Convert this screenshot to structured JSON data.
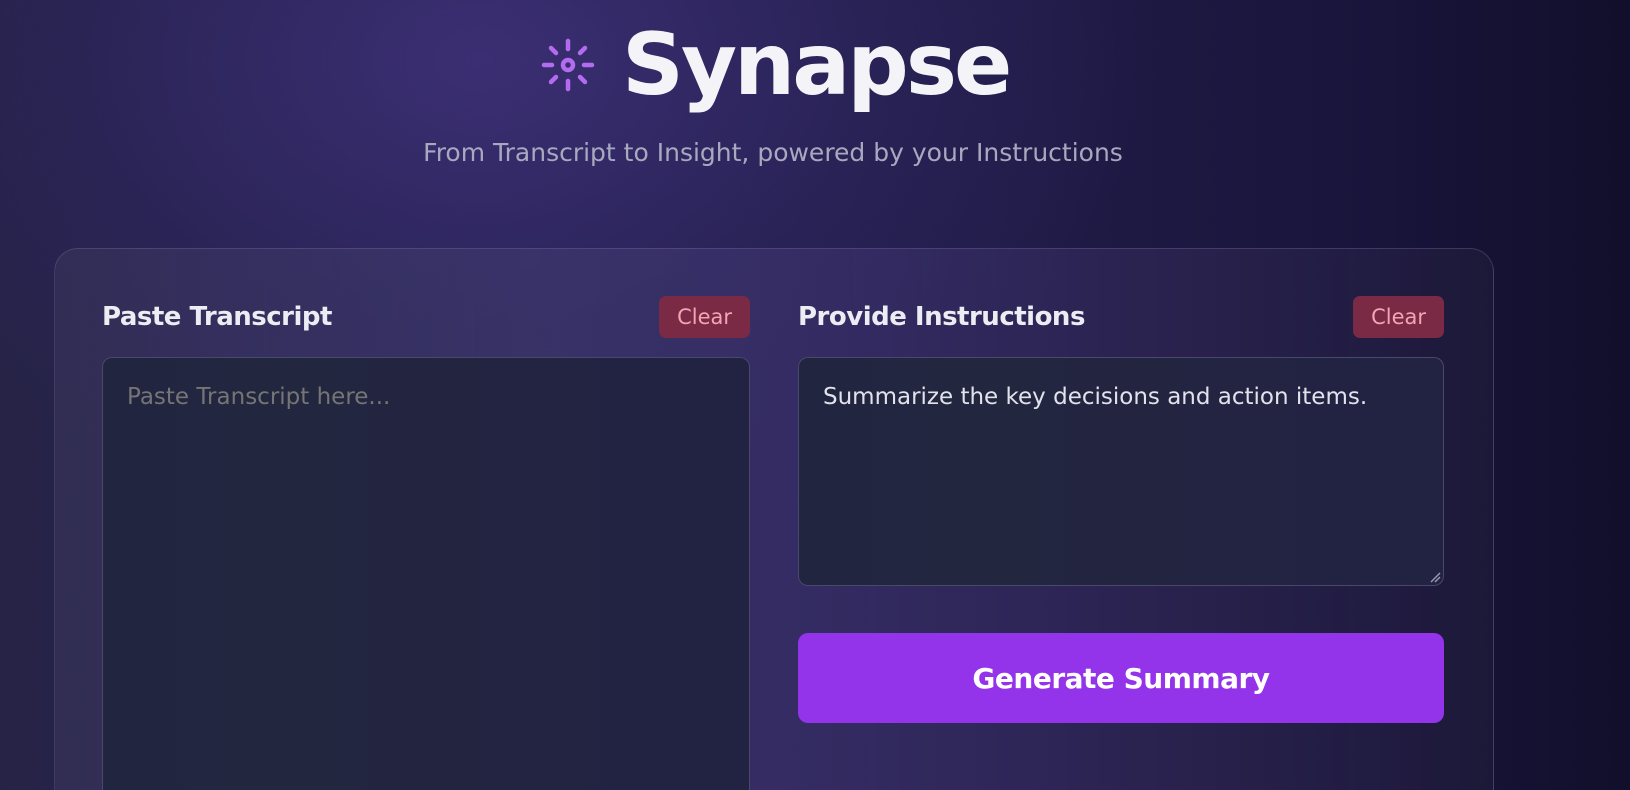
{
  "app": {
    "title": "Synapse",
    "subtitle": "From Transcript to Insight, powered by your Instructions",
    "icon": "sparkle-sun-icon",
    "accent_color": "#9333ea",
    "icon_color": "#b36cf0"
  },
  "transcript_panel": {
    "title": "Paste Transcript",
    "clear_label": "Clear",
    "placeholder": "Paste Transcript here...",
    "value": ""
  },
  "instructions_panel": {
    "title": "Provide Instructions",
    "clear_label": "Clear",
    "placeholder": "",
    "value": "Summarize the key decisions and action items."
  },
  "actions": {
    "generate_label": "Generate Summary"
  }
}
